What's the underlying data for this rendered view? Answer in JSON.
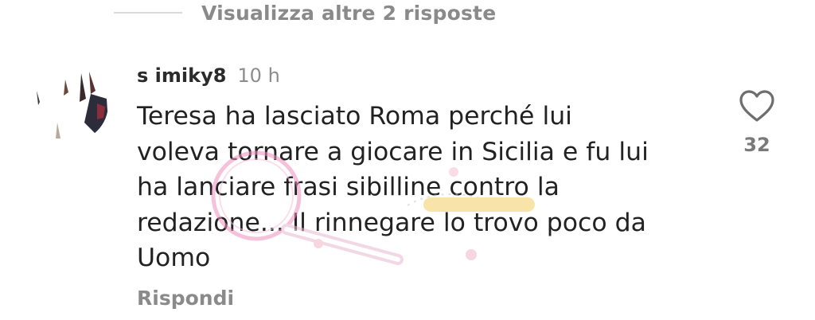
{
  "thread": {
    "view_more_label": "Visualizza altre 2 risposte"
  },
  "comment": {
    "username": "s imiky8",
    "timestamp": "10 h",
    "lines": [
      "Teresa ha lasciato Roma perché lui",
      "voleva tornare a giocare in Sicilia e fu lui",
      "ha lanciare frasi sibilline contro la",
      "redazione... Il rinnegare lo trovo poco da",
      "Uomo"
    ],
    "reply_label": "Rispondi",
    "likes": "32"
  },
  "icons": {
    "like": "heart-outline-icon",
    "avatar": "user-avatar"
  },
  "colors": {
    "muted_text": "#8a8a8a",
    "body_text": "#222222",
    "watermark_pink": "#f08fbd"
  }
}
